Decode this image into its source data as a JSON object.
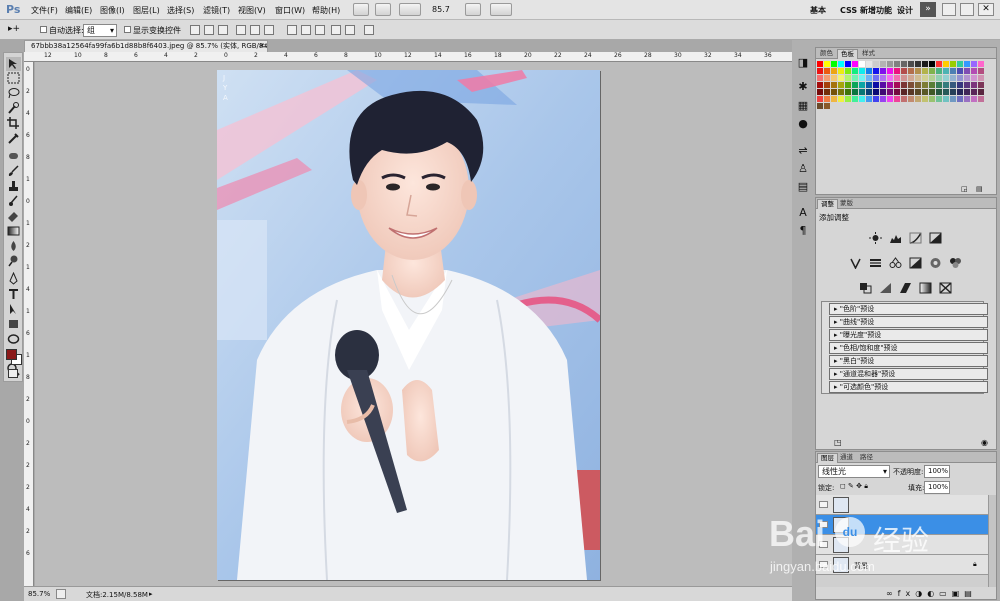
{
  "app": {
    "logo": "Ps",
    "menus": [
      "文件(F)",
      "编辑(E)",
      "图像(I)",
      "图层(L)",
      "选择(S)",
      "滤镜(T)",
      "视图(V)",
      "窗口(W)",
      "帮助(H)"
    ],
    "zoom_menu": "85.7",
    "workspaces": {
      "basic": "基本",
      "css": "CSS 新增功能",
      "design": "设计"
    }
  },
  "options": {
    "auto_select_label": "自动选择:",
    "auto_select_value": "组",
    "show_transform_label": "显示变换控件"
  },
  "document": {
    "tab_title": "67bbb38a12564fa99fa6b1d88b8f6403.jpeg @ 85.7% (实体, RGB/8#) *",
    "ruler_h": [
      "12",
      "10",
      "8",
      "6",
      "4",
      "2",
      "0",
      "2",
      "4",
      "6",
      "8",
      "10",
      "12",
      "14",
      "16",
      "18",
      "20",
      "22",
      "24",
      "26",
      "28",
      "30",
      "32",
      "34",
      "36"
    ],
    "ruler_v": [
      "0",
      "2",
      "4",
      "6",
      "8",
      "1",
      "0",
      "1",
      "2",
      "1",
      "4",
      "1",
      "6",
      "1",
      "8",
      "2",
      "0",
      "2",
      "2",
      "2",
      "4",
      "2",
      "6"
    ],
    "photo_text": "J\nY\nA"
  },
  "status": {
    "zoom": "85.7%",
    "doc_size": "文档:2.15M/8.58M"
  },
  "panels": {
    "swatch_tabs": [
      "颜色",
      "色板",
      "样式"
    ],
    "adjust_tabs": [
      "调整",
      "蒙版"
    ],
    "adjust_title": "添加调整",
    "presets": [
      "\"色阶\"预设",
      "\"曲线\"预设",
      "\"曝光度\"预设",
      "\"色相/饱和度\"预设",
      "\"黑白\"预设",
      "\"通道混和器\"预设",
      "\"可选颜色\"预设"
    ],
    "layer_tabs": [
      "图层",
      "通道",
      "路径"
    ],
    "blend_mode": "线性光",
    "opacity_label": "不透明度:",
    "opacity_value": "100%",
    "lock_label": "锁定:",
    "fill_label": "填充:",
    "fill_value": "100%",
    "layers": [
      "",
      "",
      "",
      "背景"
    ]
  },
  "watermark": {
    "brand": "Bai",
    "du_paw": "du",
    "product": "经验",
    "url": "jingyan.baidu.com"
  },
  "colors": {
    "foreground": "#8b1a1a",
    "background": "#ffffff",
    "selection": "#3b8fe6"
  }
}
